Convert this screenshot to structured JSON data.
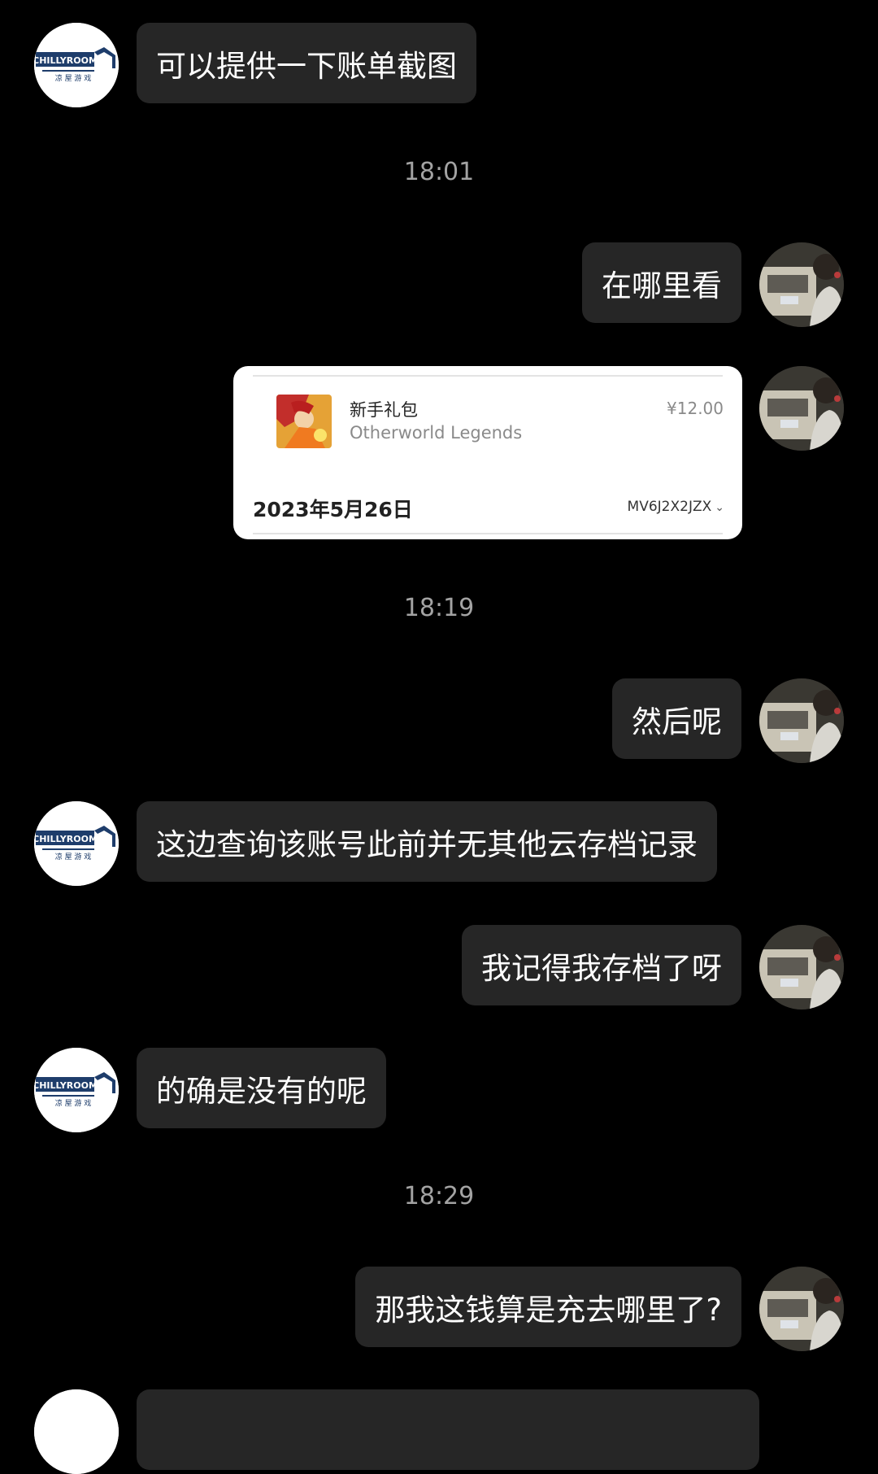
{
  "messages": [
    {
      "text": "可以提供一下账单截图"
    },
    {
      "text": "在哪里看"
    },
    {
      "text": "然后呢"
    },
    {
      "text": "这边查询该账号此前并无其他云存档记录"
    },
    {
      "text": "我记得我存档了呀"
    },
    {
      "text": "的确是没有的呢"
    },
    {
      "text": "那我这钱算是充去哪里了?"
    }
  ],
  "timestamps": [
    "18:01",
    "18:19",
    "18:29"
  ],
  "receipt": {
    "item_name": "新手礼包",
    "app_name": "Otherworld Legends",
    "price": "¥12.00",
    "date": "2023年5月26日",
    "order_id": "MV6J2X2JZX"
  },
  "support_avatar": {
    "logo_text": "CHILLYROOM",
    "sub_text": "凉 屋 游 戏",
    "brand_color": "#1e3d6b"
  },
  "icons": {
    "chevron": "chevron-down-icon"
  }
}
